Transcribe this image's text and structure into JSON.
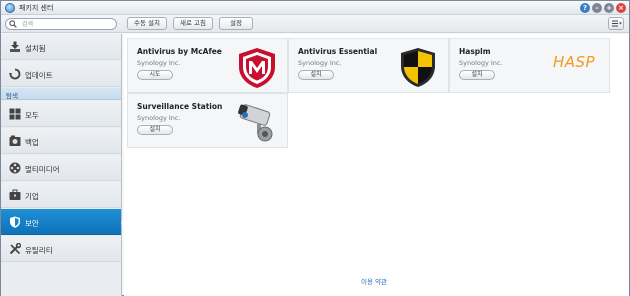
{
  "window": {
    "title": "패키지 센터"
  },
  "toolbar": {
    "search_placeholder": "검색",
    "buttons": [
      "수동 설치",
      "새로 고침",
      "설정"
    ]
  },
  "sidebar": {
    "items_top": [
      {
        "label": "설치됨",
        "icon": "download-icon"
      },
      {
        "label": "업데이트",
        "icon": "refresh-icon"
      }
    ],
    "section_label": "탐색",
    "items": [
      {
        "label": "모두",
        "icon": "grid-icon"
      },
      {
        "label": "백업",
        "icon": "backup-icon"
      },
      {
        "label": "멀티미디어",
        "icon": "film-icon"
      },
      {
        "label": "기업",
        "icon": "briefcase-icon"
      },
      {
        "label": "보안",
        "icon": "shield-icon",
        "active": true
      },
      {
        "label": "유틸리티",
        "icon": "tools-icon"
      }
    ]
  },
  "packages": [
    {
      "name": "Antivirus by McAfee",
      "vendor": "Synology Inc.",
      "action": "시도",
      "logo": "mcafee-shield-logo"
    },
    {
      "name": "Antivirus Essential",
      "vendor": "Synology Inc.",
      "action": "설치",
      "logo": "shield-logo"
    },
    {
      "name": "Hasplm",
      "vendor": "Synology Inc.",
      "action": "설치",
      "logo": "hasp-logo",
      "logo_text": "HASP"
    },
    {
      "name": "Surveillance Station",
      "vendor": "Synology Inc.",
      "action": "설치",
      "logo": "camera-logo"
    }
  ],
  "footer": {
    "terms_link": "이용 약관"
  },
  "colors": {
    "accent": "#1686cc",
    "mcafee_red": "#c8102e",
    "hasp_orange": "#f39a1e"
  }
}
